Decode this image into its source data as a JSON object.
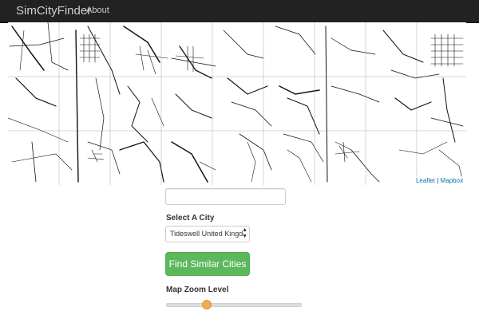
{
  "navbar": {
    "brand": "SimCityFinder",
    "about": "About"
  },
  "map": {
    "attribution_leaflet": "Leaflet",
    "attribution_sep": "|",
    "attribution_mapbox": "Mapbox"
  },
  "search": {
    "value": "",
    "placeholder": ""
  },
  "city_select": {
    "label": "Select A City",
    "selected": "Tideswell United Kingdom"
  },
  "find_button": {
    "label": "Find Similar Cities",
    "color": "#5cb85c"
  },
  "zoom": {
    "label": "Map Zoom Level",
    "value_fraction": 0.3,
    "thumb_color": "#f0ad4e"
  }
}
